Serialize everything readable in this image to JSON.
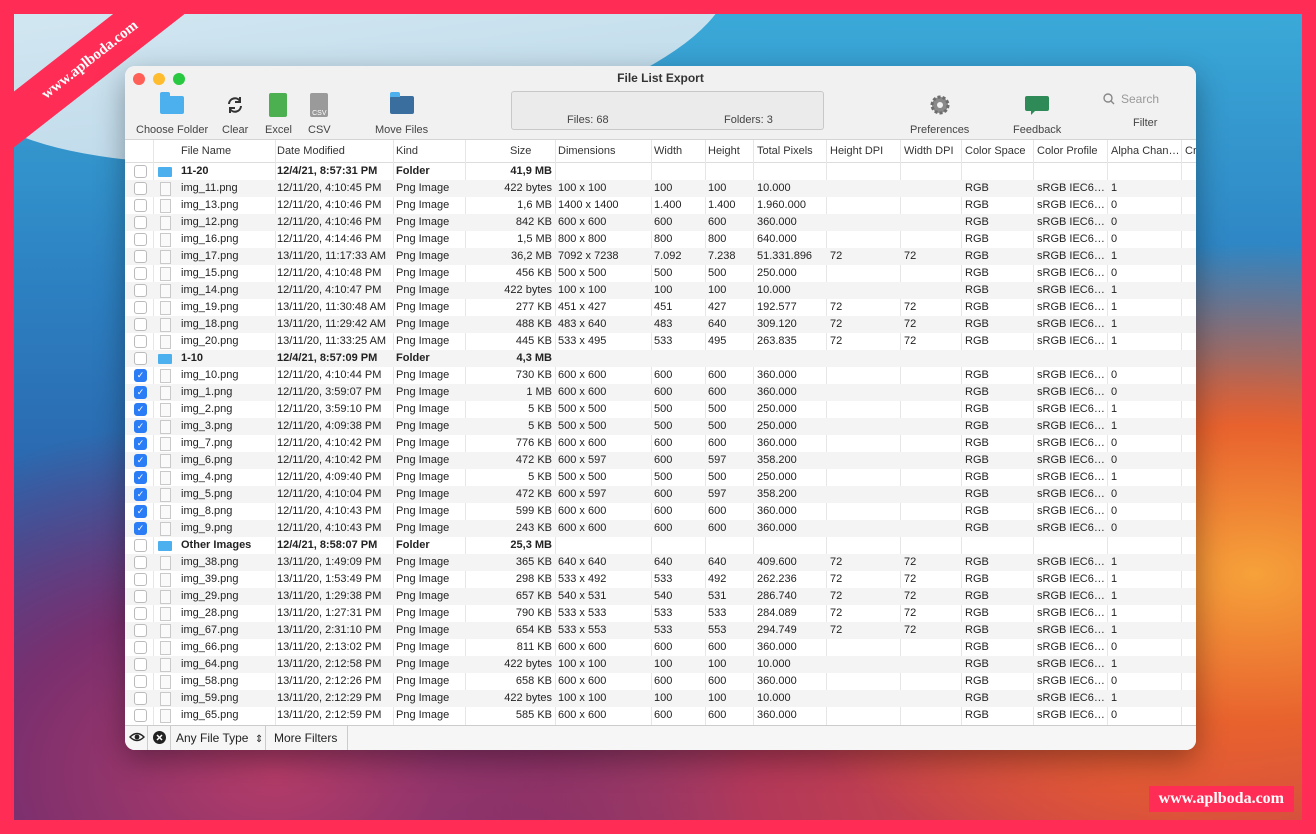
{
  "watermark": {
    "top": "www.aplboda.com",
    "bottom": "www.aplboda.com"
  },
  "window": {
    "title": "File List Export"
  },
  "toolbar": {
    "choose_folder": "Choose Folder",
    "clear": "Clear",
    "excel": "Excel",
    "csv": "CSV",
    "move_files": "Move Files",
    "preferences": "Preferences",
    "feedback": "Feedback",
    "filter": "Filter",
    "search_placeholder": "Search",
    "csv_icon_text": "CSV"
  },
  "status": {
    "files": "Files: 68",
    "folders": "Folders: 3"
  },
  "columns": [
    "File Name",
    "Date Modified",
    "Kind",
    "Size",
    "Dimensions",
    "Width",
    "Height",
    "Total Pixels",
    "Height DPI",
    "Width DPI",
    "Color Space",
    "Color Profile",
    "Alpha Chan…",
    "Cr"
  ],
  "rows": [
    {
      "t": "folder",
      "checked": false,
      "name": "11-20",
      "date": "12/4/21, 8:57:31 PM",
      "kind": "Folder",
      "size": "41,9 MB",
      "dim": "",
      "w": "",
      "h": "",
      "tp": "",
      "hdpi": "",
      "wdpi": "",
      "cs": "",
      "cp": "",
      "a": ""
    },
    {
      "t": "file",
      "checked": false,
      "name": "img_11.png",
      "date": "12/11/20, 4:10:45 PM",
      "kind": "Png Image",
      "size": "422 bytes",
      "dim": "100 x 100",
      "w": "100",
      "h": "100",
      "tp": "10.000",
      "hdpi": "",
      "wdpi": "",
      "cs": "RGB",
      "cp": "sRGB IEC6…",
      "a": "1"
    },
    {
      "t": "file",
      "checked": false,
      "name": "img_13.png",
      "date": "12/11/20, 4:10:46 PM",
      "kind": "Png Image",
      "size": "1,6 MB",
      "dim": "1400 x 1400",
      "w": "1.400",
      "h": "1.400",
      "tp": "1.960.000",
      "hdpi": "",
      "wdpi": "",
      "cs": "RGB",
      "cp": "sRGB IEC6…",
      "a": "0"
    },
    {
      "t": "file",
      "checked": false,
      "name": "img_12.png",
      "date": "12/11/20, 4:10:46 PM",
      "kind": "Png Image",
      "size": "842 KB",
      "dim": "600 x 600",
      "w": "600",
      "h": "600",
      "tp": "360.000",
      "hdpi": "",
      "wdpi": "",
      "cs": "RGB",
      "cp": "sRGB IEC6…",
      "a": "0"
    },
    {
      "t": "file",
      "checked": false,
      "name": "img_16.png",
      "date": "12/11/20, 4:14:46 PM",
      "kind": "Png Image",
      "size": "1,5 MB",
      "dim": "800 x 800",
      "w": "800",
      "h": "800",
      "tp": "640.000",
      "hdpi": "",
      "wdpi": "",
      "cs": "RGB",
      "cp": "sRGB IEC6…",
      "a": "0"
    },
    {
      "t": "file",
      "checked": false,
      "name": "img_17.png",
      "date": "13/11/20, 11:17:33 AM",
      "kind": "Png Image",
      "size": "36,2 MB",
      "dim": "7092 x 7238",
      "w": "7.092",
      "h": "7.238",
      "tp": "51.331.896",
      "hdpi": "72",
      "wdpi": "72",
      "cs": "RGB",
      "cp": "sRGB IEC6…",
      "a": "1"
    },
    {
      "t": "file",
      "checked": false,
      "name": "img_15.png",
      "date": "12/11/20, 4:10:48 PM",
      "kind": "Png Image",
      "size": "456 KB",
      "dim": "500 x 500",
      "w": "500",
      "h": "500",
      "tp": "250.000",
      "hdpi": "",
      "wdpi": "",
      "cs": "RGB",
      "cp": "sRGB IEC6…",
      "a": "0"
    },
    {
      "t": "file",
      "checked": false,
      "name": "img_14.png",
      "date": "12/11/20, 4:10:47 PM",
      "kind": "Png Image",
      "size": "422 bytes",
      "dim": "100 x 100",
      "w": "100",
      "h": "100",
      "tp": "10.000",
      "hdpi": "",
      "wdpi": "",
      "cs": "RGB",
      "cp": "sRGB IEC6…",
      "a": "1"
    },
    {
      "t": "file",
      "checked": false,
      "name": "img_19.png",
      "date": "13/11/20, 11:30:48 AM",
      "kind": "Png Image",
      "size": "277 KB",
      "dim": "451 x 427",
      "w": "451",
      "h": "427",
      "tp": "192.577",
      "hdpi": "72",
      "wdpi": "72",
      "cs": "RGB",
      "cp": "sRGB IEC6…",
      "a": "1"
    },
    {
      "t": "file",
      "checked": false,
      "name": "img_18.png",
      "date": "13/11/20, 11:29:42 AM",
      "kind": "Png Image",
      "size": "488 KB",
      "dim": "483 x 640",
      "w": "483",
      "h": "640",
      "tp": "309.120",
      "hdpi": "72",
      "wdpi": "72",
      "cs": "RGB",
      "cp": "sRGB IEC6…",
      "a": "1"
    },
    {
      "t": "file",
      "checked": false,
      "name": "img_20.png",
      "date": "13/11/20, 11:33:25 AM",
      "kind": "Png Image",
      "size": "445 KB",
      "dim": "533 x 495",
      "w": "533",
      "h": "495",
      "tp": "263.835",
      "hdpi": "72",
      "wdpi": "72",
      "cs": "RGB",
      "cp": "sRGB IEC6…",
      "a": "1"
    },
    {
      "t": "folder",
      "checked": false,
      "name": "1-10",
      "date": "12/4/21, 8:57:09 PM",
      "kind": "Folder",
      "size": "4,3 MB",
      "dim": "",
      "w": "",
      "h": "",
      "tp": "",
      "hdpi": "",
      "wdpi": "",
      "cs": "",
      "cp": "",
      "a": ""
    },
    {
      "t": "file",
      "checked": true,
      "name": "img_10.png",
      "date": "12/11/20, 4:10:44 PM",
      "kind": "Png Image",
      "size": "730 KB",
      "dim": "600 x 600",
      "w": "600",
      "h": "600",
      "tp": "360.000",
      "hdpi": "",
      "wdpi": "",
      "cs": "RGB",
      "cp": "sRGB IEC6…",
      "a": "0"
    },
    {
      "t": "file",
      "checked": true,
      "name": "img_1.png",
      "date": "12/11/20, 3:59:07 PM",
      "kind": "Png Image",
      "size": "1 MB",
      "dim": "600 x 600",
      "w": "600",
      "h": "600",
      "tp": "360.000",
      "hdpi": "",
      "wdpi": "",
      "cs": "RGB",
      "cp": "sRGB IEC6…",
      "a": "0"
    },
    {
      "t": "file",
      "checked": true,
      "name": "img_2.png",
      "date": "12/11/20, 3:59:10 PM",
      "kind": "Png Image",
      "size": "5 KB",
      "dim": "500 x 500",
      "w": "500",
      "h": "500",
      "tp": "250.000",
      "hdpi": "",
      "wdpi": "",
      "cs": "RGB",
      "cp": "sRGB IEC6…",
      "a": "1"
    },
    {
      "t": "file",
      "checked": true,
      "name": "img_3.png",
      "date": "12/11/20, 4:09:38 PM",
      "kind": "Png Image",
      "size": "5 KB",
      "dim": "500 x 500",
      "w": "500",
      "h": "500",
      "tp": "250.000",
      "hdpi": "",
      "wdpi": "",
      "cs": "RGB",
      "cp": "sRGB IEC6…",
      "a": "1"
    },
    {
      "t": "file",
      "checked": true,
      "name": "img_7.png",
      "date": "12/11/20, 4:10:42 PM",
      "kind": "Png Image",
      "size": "776 KB",
      "dim": "600 x 600",
      "w": "600",
      "h": "600",
      "tp": "360.000",
      "hdpi": "",
      "wdpi": "",
      "cs": "RGB",
      "cp": "sRGB IEC6…",
      "a": "0"
    },
    {
      "t": "file",
      "checked": true,
      "name": "img_6.png",
      "date": "12/11/20, 4:10:42 PM",
      "kind": "Png Image",
      "size": "472 KB",
      "dim": "600 x 597",
      "w": "600",
      "h": "597",
      "tp": "358.200",
      "hdpi": "",
      "wdpi": "",
      "cs": "RGB",
      "cp": "sRGB IEC6…",
      "a": "0"
    },
    {
      "t": "file",
      "checked": true,
      "name": "img_4.png",
      "date": "12/11/20, 4:09:40 PM",
      "kind": "Png Image",
      "size": "5 KB",
      "dim": "500 x 500",
      "w": "500",
      "h": "500",
      "tp": "250.000",
      "hdpi": "",
      "wdpi": "",
      "cs": "RGB",
      "cp": "sRGB IEC6…",
      "a": "1"
    },
    {
      "t": "file",
      "checked": true,
      "name": "img_5.png",
      "date": "12/11/20, 4:10:04 PM",
      "kind": "Png Image",
      "size": "472 KB",
      "dim": "600 x 597",
      "w": "600",
      "h": "597",
      "tp": "358.200",
      "hdpi": "",
      "wdpi": "",
      "cs": "RGB",
      "cp": "sRGB IEC6…",
      "a": "0"
    },
    {
      "t": "file",
      "checked": true,
      "name": "img_8.png",
      "date": "12/11/20, 4:10:43 PM",
      "kind": "Png Image",
      "size": "599 KB",
      "dim": "600 x 600",
      "w": "600",
      "h": "600",
      "tp": "360.000",
      "hdpi": "",
      "wdpi": "",
      "cs": "RGB",
      "cp": "sRGB IEC6…",
      "a": "0"
    },
    {
      "t": "file",
      "checked": true,
      "name": "img_9.png",
      "date": "12/11/20, 4:10:43 PM",
      "kind": "Png Image",
      "size": "243 KB",
      "dim": "600 x 600",
      "w": "600",
      "h": "600",
      "tp": "360.000",
      "hdpi": "",
      "wdpi": "",
      "cs": "RGB",
      "cp": "sRGB IEC6…",
      "a": "0"
    },
    {
      "t": "folder",
      "checked": false,
      "name": "Other Images",
      "date": "12/4/21, 8:58:07 PM",
      "kind": "Folder",
      "size": "25,3 MB",
      "dim": "",
      "w": "",
      "h": "",
      "tp": "",
      "hdpi": "",
      "wdpi": "",
      "cs": "",
      "cp": "",
      "a": ""
    },
    {
      "t": "file",
      "checked": false,
      "name": "img_38.png",
      "date": "13/11/20, 1:49:09 PM",
      "kind": "Png Image",
      "size": "365 KB",
      "dim": "640 x 640",
      "w": "640",
      "h": "640",
      "tp": "409.600",
      "hdpi": "72",
      "wdpi": "72",
      "cs": "RGB",
      "cp": "sRGB IEC6…",
      "a": "1"
    },
    {
      "t": "file",
      "checked": false,
      "name": "img_39.png",
      "date": "13/11/20, 1:53:49 PM",
      "kind": "Png Image",
      "size": "298 KB",
      "dim": "533 x 492",
      "w": "533",
      "h": "492",
      "tp": "262.236",
      "hdpi": "72",
      "wdpi": "72",
      "cs": "RGB",
      "cp": "sRGB IEC6…",
      "a": "1"
    },
    {
      "t": "file",
      "checked": false,
      "name": "img_29.png",
      "date": "13/11/20, 1:29:38 PM",
      "kind": "Png Image",
      "size": "657 KB",
      "dim": "540 x 531",
      "w": "540",
      "h": "531",
      "tp": "286.740",
      "hdpi": "72",
      "wdpi": "72",
      "cs": "RGB",
      "cp": "sRGB IEC6…",
      "a": "1"
    },
    {
      "t": "file",
      "checked": false,
      "name": "img_28.png",
      "date": "13/11/20, 1:27:31 PM",
      "kind": "Png Image",
      "size": "790 KB",
      "dim": "533 x 533",
      "w": "533",
      "h": "533",
      "tp": "284.089",
      "hdpi": "72",
      "wdpi": "72",
      "cs": "RGB",
      "cp": "sRGB IEC6…",
      "a": "1"
    },
    {
      "t": "file",
      "checked": false,
      "name": "img_67.png",
      "date": "13/11/20, 2:31:10 PM",
      "kind": "Png Image",
      "size": "654 KB",
      "dim": "533 x 553",
      "w": "533",
      "h": "553",
      "tp": "294.749",
      "hdpi": "72",
      "wdpi": "72",
      "cs": "RGB",
      "cp": "sRGB IEC6…",
      "a": "1"
    },
    {
      "t": "file",
      "checked": false,
      "name": "img_66.png",
      "date": "13/11/20, 2:13:02 PM",
      "kind": "Png Image",
      "size": "811 KB",
      "dim": "600 x 600",
      "w": "600",
      "h": "600",
      "tp": "360.000",
      "hdpi": "",
      "wdpi": "",
      "cs": "RGB",
      "cp": "sRGB IEC6…",
      "a": "0"
    },
    {
      "t": "file",
      "checked": false,
      "name": "img_64.png",
      "date": "13/11/20, 2:12:58 PM",
      "kind": "Png Image",
      "size": "422 bytes",
      "dim": "100 x 100",
      "w": "100",
      "h": "100",
      "tp": "10.000",
      "hdpi": "",
      "wdpi": "",
      "cs": "RGB",
      "cp": "sRGB IEC6…",
      "a": "1"
    },
    {
      "t": "file",
      "checked": false,
      "name": "img_58.png",
      "date": "13/11/20, 2:12:26 PM",
      "kind": "Png Image",
      "size": "658 KB",
      "dim": "600 x 600",
      "w": "600",
      "h": "600",
      "tp": "360.000",
      "hdpi": "",
      "wdpi": "",
      "cs": "RGB",
      "cp": "sRGB IEC6…",
      "a": "0"
    },
    {
      "t": "file",
      "checked": false,
      "name": "img_59.png",
      "date": "13/11/20, 2:12:29 PM",
      "kind": "Png Image",
      "size": "422 bytes",
      "dim": "100 x 100",
      "w": "100",
      "h": "100",
      "tp": "10.000",
      "hdpi": "",
      "wdpi": "",
      "cs": "RGB",
      "cp": "sRGB IEC6…",
      "a": "1"
    },
    {
      "t": "file",
      "checked": false,
      "name": "img_65.png",
      "date": "13/11/20, 2:12:59 PM",
      "kind": "Png Image",
      "size": "585 KB",
      "dim": "600 x 600",
      "w": "600",
      "h": "600",
      "tp": "360.000",
      "hdpi": "",
      "wdpi": "",
      "cs": "RGB",
      "cp": "sRGB IEC6…",
      "a": "0"
    }
  ],
  "footer": {
    "file_type": "Any File Type",
    "more_filters": "More Filters"
  },
  "colors": {
    "accent": "#2b7df6",
    "folder": "#4db0ee",
    "frame": "#ff2d55",
    "excel": "#4caf50",
    "feedback": "#2e8b57"
  }
}
